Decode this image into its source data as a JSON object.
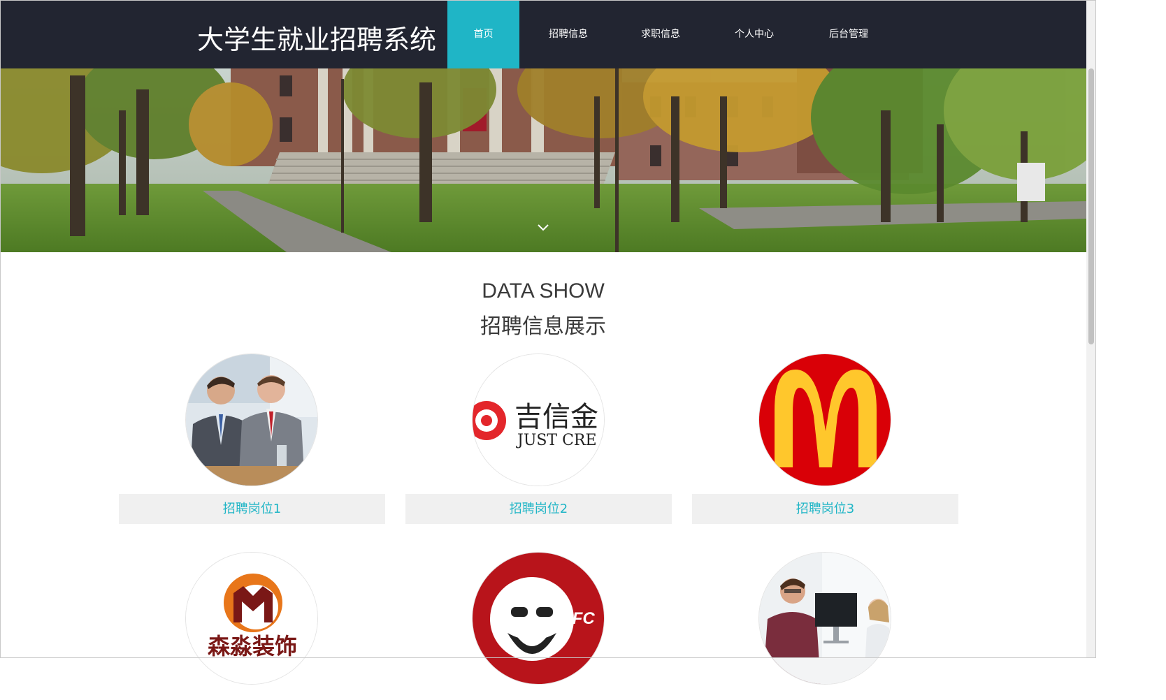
{
  "nav": {
    "brand": "大学生就业招聘系统",
    "items": [
      {
        "label": "首页",
        "active": true
      },
      {
        "label": "招聘信息",
        "active": false
      },
      {
        "label": "求职信息",
        "active": false
      },
      {
        "label": "个人中心",
        "active": false
      },
      {
        "label": "后台管理",
        "active": false
      }
    ]
  },
  "section": {
    "title_en": "DATA SHOW",
    "title_zh": "招聘信息展示"
  },
  "jobs": [
    {
      "label": "招聘岗位1",
      "image": "business-meeting-photo"
    },
    {
      "label": "招聘岗位2",
      "image": "just-credit-logo",
      "logo_text_zh": "吉信金",
      "logo_text_en": "JUST CRE"
    },
    {
      "label": "招聘岗位3",
      "image": "mcdonalds-logo"
    },
    {
      "label": "",
      "image": "senmiao-decoration-logo",
      "logo_text_zh": "森淼装饰"
    },
    {
      "label": "",
      "image": "kfc-logo",
      "logo_text_en": "KFC"
    },
    {
      "label": "",
      "image": "office-interview-photo"
    }
  ],
  "colors": {
    "nav_bg": "#222531",
    "accent": "#1fb5c6",
    "caption_bg": "#f0f0f0"
  }
}
